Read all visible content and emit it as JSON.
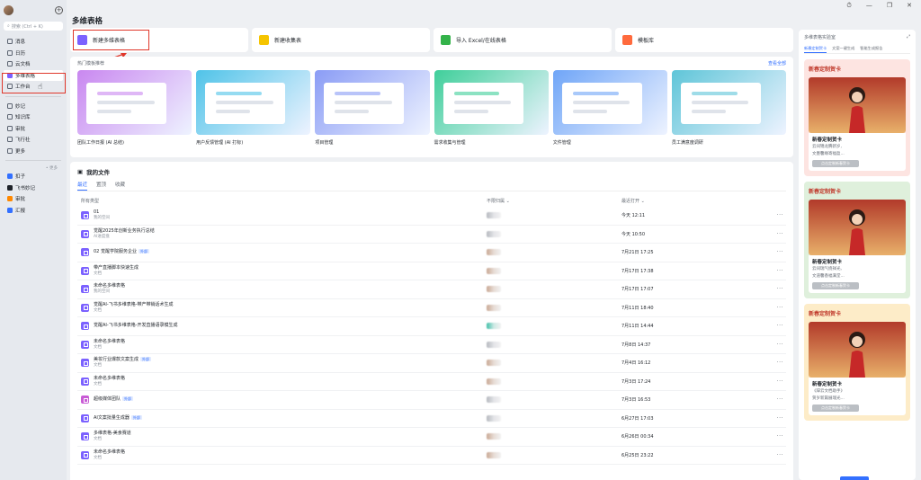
{
  "window_controls": {
    "history": "⏱",
    "minimize": "—",
    "restore": "❐",
    "close": "✕"
  },
  "sidebar": {
    "search_placeholder": "搜索 (Ctrl + K)",
    "items": [
      {
        "label": "消息",
        "icon": "chat-icon"
      },
      {
        "label": "日历",
        "icon": "calendar-icon"
      },
      {
        "label": "云文档",
        "icon": "cloud-doc-icon"
      },
      {
        "label": "多维表格",
        "icon": "base-icon"
      },
      {
        "label": "工作台",
        "icon": "workspace-icon"
      },
      {
        "label": "妙记",
        "icon": "minutes-icon"
      },
      {
        "label": "知识库",
        "icon": "wiki-icon"
      },
      {
        "label": "审批",
        "icon": "approval-icon"
      },
      {
        "label": "飞行社",
        "icon": "plane-icon"
      },
      {
        "label": "更多",
        "icon": "more-icon"
      }
    ],
    "more_hint": "• 更多",
    "apps": [
      {
        "label": "扣子",
        "color": "#3370ff"
      },
      {
        "label": "飞书妙记",
        "color": "#1f2329"
      },
      {
        "label": "审批",
        "color": "#ff8800"
      },
      {
        "label": "汇报",
        "color": "#3370ff"
      }
    ]
  },
  "main": {
    "title": "多维表格",
    "actions": [
      {
        "label": "新建多维表格",
        "color": "#7b61ff"
      },
      {
        "label": "新建收集表",
        "color": "#f5c400"
      },
      {
        "label": "导入 Excel/在线表格",
        "color": "#34b34a"
      },
      {
        "label": "模板库",
        "color": "#ff6a3d"
      }
    ],
    "templates": {
      "heading": "热门模板推荐",
      "view_all": "查看全部",
      "items": [
        {
          "label": "团队工作日报 (AI 总结)",
          "bg": "#c987f0"
        },
        {
          "label": "用户反馈管理 (AI 打标)",
          "bg": "#4fc3e8"
        },
        {
          "label": "项目管理",
          "bg": "#8a9cf5"
        },
        {
          "label": "需求收集与管理",
          "bg": "#3fcf9a"
        },
        {
          "label": "文件管理",
          "bg": "#6fa5f7"
        },
        {
          "label": "员工满意度调研",
          "bg": "#5ec5d8"
        }
      ]
    },
    "files": {
      "title": "我的文件",
      "tabs": [
        "最近",
        "置顶",
        "收藏"
      ],
      "columns": {
        "name": "所有类型",
        "owner": "不限归属",
        "time": "最近打开"
      },
      "rows": [
        {
          "name": "01",
          "sub": "我的空间",
          "time": "今天 12:11",
          "tag": "",
          "owner": "grey"
        },
        {
          "name": "觉醒2025年创新业务执行总结",
          "sub": "AI进度盘",
          "time": "今天 10:50",
          "tag": "",
          "owner": "grey"
        },
        {
          "name": "02 觉醒学院服务企业",
          "sub": "",
          "time": "7月21日 17:25",
          "tag": "外部",
          "owner": "brown"
        },
        {
          "name": "带产直播脚本快速生成",
          "sub": "文档",
          "time": "7月17日 17:38",
          "tag": "",
          "owner": "brown"
        },
        {
          "name": "未命名多维表格",
          "sub": "我的空间",
          "time": "7月17日 17:07",
          "tag": "",
          "owner": "brown"
        },
        {
          "name": "觉醒AI-飞书多维表格-带产带销话术生成",
          "sub": "文档",
          "time": "7月11日 18:40",
          "tag": "",
          "owner": "brown"
        },
        {
          "name": "觉醒AI-飞书多维表格-开发直播语录模生成",
          "sub": "",
          "time": "7月11日 14:44",
          "tag": "",
          "owner": "teal"
        },
        {
          "name": "未命名多维表格",
          "sub": "文档",
          "time": "7月8日 14:37",
          "tag": "",
          "owner": "grey"
        },
        {
          "name": "美妆行业爆款文案生成",
          "sub": "文档",
          "time": "7月4日 16:12",
          "tag": "外部",
          "owner": "brown"
        },
        {
          "name": "未命名多维表格",
          "sub": "文档",
          "time": "7月3日 17:24",
          "tag": "",
          "owner": "brown"
        },
        {
          "name": "超级媒体团队",
          "sub": "",
          "time": "7月3日 16:53",
          "tag": "外部",
          "owner": "grey",
          "pink": true
        },
        {
          "name": "AI文案批量生成器",
          "sub": "",
          "time": "6月27日 17:03",
          "tag": "外部",
          "owner": "grey"
        },
        {
          "name": "多维表格-美食赛道",
          "sub": "文档",
          "time": "6月26日 00:34",
          "tag": "",
          "owner": "brown"
        },
        {
          "name": "未命名多维表格",
          "sub": "文档",
          "time": "6月25日 23:22",
          "tag": "",
          "owner": "brown"
        }
      ],
      "more_dots": "···"
    }
  },
  "right_panel": {
    "title": "多维表格实验室",
    "tabs": [
      "新春定制贺卡",
      "文案一键生成",
      "智能生成报告"
    ],
    "promos": [
      {
        "head": "新春定制贺卡",
        "title": "新春定制贺卡",
        "desc": [
          "云间锦龙腾新岁,",
          "文墨馨缘寄福盈..."
        ],
        "button": "点击定制新春贺卡",
        "bg": "#fde4e1"
      },
      {
        "head": "新春定制贺卡",
        "title": "新春定制贺卡",
        "desc": [
          "云间瑞气绕祥光,",
          "文道馨香福满堂..."
        ],
        "button": "点击定制新春贺卡",
        "bg": "#dff0dc"
      },
      {
        "head": "新春定制贺卡",
        "title": "新春定制贺卡",
        "desc": [
          "《辞云文档助手》",
          "贺岁新篇展瑞光..."
        ],
        "button": "点击定制新春贺卡",
        "bg": "#fdecc8"
      }
    ]
  }
}
